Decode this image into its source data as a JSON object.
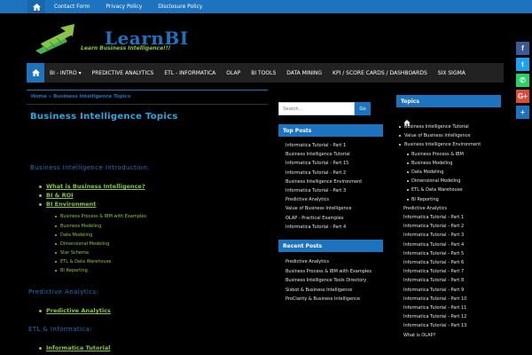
{
  "topbar": {
    "links": [
      "Contact Form",
      "Privacy Policy",
      "Disclosure Policy"
    ]
  },
  "logo": {
    "brand": "LearnBI",
    "tagline": "Learn Business Intelligence!!!"
  },
  "nav": {
    "items": [
      "BI - INTRO ▾",
      "PREDICTIVE ANALYTICS",
      "ETL - INFORMATICA",
      "OLAP",
      "BI TOOLS",
      "DATA MINING",
      "KPI / SCORE CARDS / DASHBOARDS",
      "SIX SIGMA"
    ]
  },
  "breadcrumb": "Home » Business Intelligence Topics",
  "page": {
    "title": "Business Intelligence Topics",
    "sections": [
      "Business Intelligence Introduction:",
      "Predictive Analytics:",
      "ETL & Informatica:"
    ],
    "intro_links": [
      "What is Business Intelligence?",
      "BI & ROI",
      "BI Environment"
    ],
    "env_links": [
      "Business Process & IBM with Examples",
      "Business Modeling",
      "Data Modeling",
      "Dimensional Modeling",
      "Star Schema",
      "ETL & Data Warehouse",
      "BI Reporting"
    ],
    "pa_link": "Predictive Analytics",
    "etl_link": "Informatica Tutorial"
  },
  "middle": {
    "search_placeholder": "Search...",
    "search_button": "Go",
    "top_posts_title": "Top Posts",
    "top_posts": [
      "Informatica Tutorial - Part 1",
      "Business Intelligence Tutorial",
      "Informatica Tutorial - Part 15",
      "Informatica Tutorial - Part 2",
      "Business Intelligence Environment",
      "Informatica Tutorial - Part 3",
      "Predictive Analytics",
      "Value of Business Intelligence",
      "OLAP - Practical Examples",
      "Informatica Tutorial - Part 4"
    ],
    "recent_posts_title": "Recent Posts",
    "recent_posts": [
      "Predictive Analytics",
      "Business Process & IBM with Examples",
      "Business Intelligence Tools Directory",
      "Sisbot & Business Intelligence",
      "ProClarity & Business Intelligence"
    ]
  },
  "right": {
    "title": "Topics",
    "items": [
      {
        "t": "Business Intelligence Tutorial",
        "lvl": 1
      },
      {
        "t": "Value of Business Intelligence",
        "lvl": 1
      },
      {
        "t": "Business Intelligence Environment",
        "lvl": 1
      },
      {
        "t": "Business Process & IBM",
        "lvl": 2
      },
      {
        "t": "Business Modeling",
        "lvl": 2
      },
      {
        "t": "Data Modeling",
        "lvl": 2
      },
      {
        "t": "Dimensional Modeling",
        "lvl": 2
      },
      {
        "t": "ETL & Data Warehouse",
        "lvl": 2
      },
      {
        "t": "BI Reporting",
        "lvl": 2
      },
      {
        "t": "Predictive Analytics",
        "lvl": 0
      },
      {
        "t": "Informatica Tutorial - Part 1",
        "lvl": 0
      },
      {
        "t": "Informatica Tutorial - Part 2",
        "lvl": 0
      },
      {
        "t": "Informatica Tutorial - Part 3",
        "lvl": 0
      },
      {
        "t": "Informatica Tutorial - Part 4",
        "lvl": 0
      },
      {
        "t": "Informatica Tutorial - Part 5",
        "lvl": 0
      },
      {
        "t": "Informatica Tutorial - Part 6",
        "lvl": 0
      },
      {
        "t": "Informatica Tutorial - Part 7",
        "lvl": 0
      },
      {
        "t": "Informatica Tutorial - Part 8",
        "lvl": 0
      },
      {
        "t": "Informatica Tutorial - Part 9",
        "lvl": 0
      },
      {
        "t": "Informatica Tutorial - Part 10",
        "lvl": 0
      },
      {
        "t": "Informatica Tutorial - Part 11",
        "lvl": 0
      },
      {
        "t": "Informatica Tutorial - Part 12",
        "lvl": 0
      },
      {
        "t": "Informatica Tutorial - Part 13",
        "lvl": 0
      },
      {
        "t": "What is OLAP?",
        "lvl": 0
      }
    ]
  },
  "share": [
    {
      "name": "facebook-icon",
      "glyph": "f",
      "color": "#3b5998"
    },
    {
      "name": "twitter-icon",
      "glyph": "t",
      "color": "#1da1f2"
    },
    {
      "name": "whatsapp-icon",
      "glyph": "✆",
      "color": "#25d366"
    },
    {
      "name": "google-plus-icon",
      "glyph": "G+",
      "color": "#dd4b39"
    },
    {
      "name": "share-icon",
      "glyph": "+",
      "color": "#1e73be"
    }
  ]
}
